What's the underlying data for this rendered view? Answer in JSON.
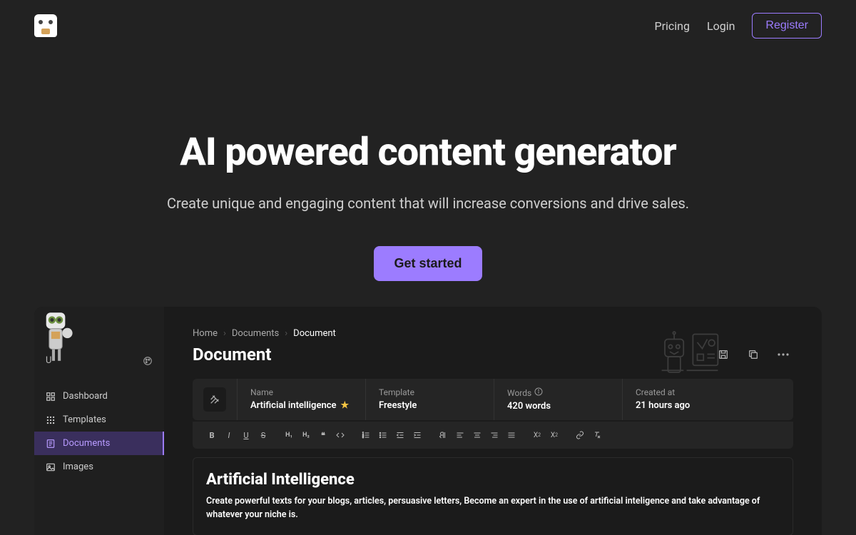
{
  "nav": {
    "pricing": "Pricing",
    "login": "Login",
    "register": "Register"
  },
  "hero": {
    "title": "AI powered content generator",
    "subtitle": "Create unique and engaging content that will increase conversions and drive sales.",
    "cta": "Get started"
  },
  "preview": {
    "sidebar": {
      "user_label": "U",
      "items": [
        {
          "label": "Dashboard",
          "icon": "dashboard"
        },
        {
          "label": "Templates",
          "icon": "grid"
        },
        {
          "label": "Documents",
          "icon": "doc",
          "active": true
        },
        {
          "label": "Images",
          "icon": "image"
        }
      ]
    },
    "breadcrumb": {
      "home": "Home",
      "documents": "Documents",
      "current": "Document"
    },
    "page_title": "Document",
    "meta": {
      "name_label": "Name",
      "name_value": "Artificial intelligence",
      "template_label": "Template",
      "template_value": "Freestyle",
      "words_label": "Words",
      "words_value": "420 words",
      "created_label": "Created at",
      "created_value": "21 hours ago"
    },
    "editor": {
      "heading": "Artificial Intelligence",
      "body": "Create powerful texts for your blogs, articles, persuasive letters, Become an expert in the use of artificial inteligence and take advantage of whatever your niche is."
    }
  }
}
